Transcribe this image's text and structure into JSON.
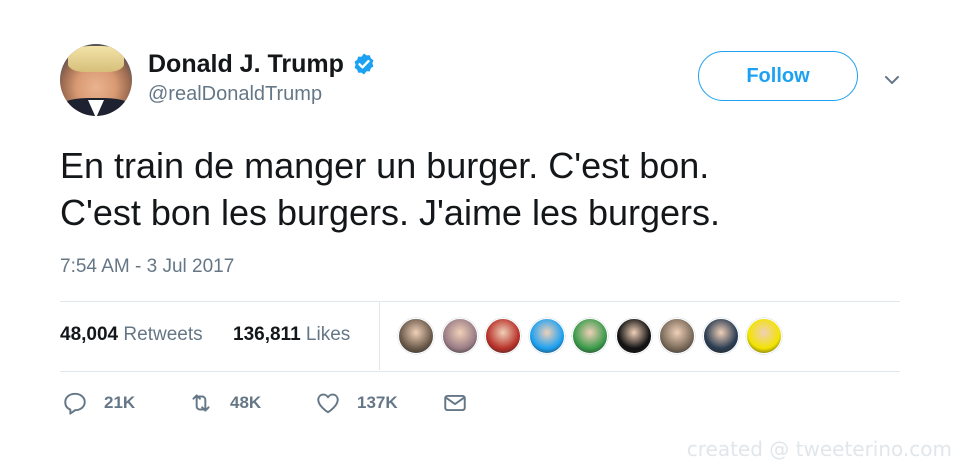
{
  "author": {
    "display_name": "Donald J. Trump",
    "handle": "@realDonaldTrump",
    "verified": true,
    "avatar_icon": "profile-photo"
  },
  "follow_label": "Follow",
  "tweet": {
    "line1": "En train de manger un burger. C'est bon.",
    "line2": "C'est bon les burgers. J'aime les burgers.",
    "timestamp": "7:54 AM - 3 Jul 2017"
  },
  "stats": {
    "retweets_count": "48,004",
    "retweets_label": "Retweets",
    "likes_count": "136,811",
    "likes_label": "Likes"
  },
  "likers": [
    {
      "icon": "liker-avatar-1",
      "color": "#6b5a4a"
    },
    {
      "icon": "liker-avatar-2",
      "color": "#9a7d86"
    },
    {
      "icon": "liker-avatar-3",
      "color": "#b8322a"
    },
    {
      "icon": "liker-avatar-4",
      "color": "#1da1f2"
    },
    {
      "icon": "liker-avatar-5",
      "color": "#3a9b4a"
    },
    {
      "icon": "liker-avatar-6",
      "color": "#111111"
    },
    {
      "icon": "liker-avatar-7",
      "color": "#7a6a5a"
    },
    {
      "icon": "liker-avatar-8",
      "color": "#2b3d52"
    },
    {
      "icon": "liker-avatar-9",
      "color": "#f2e300"
    }
  ],
  "actions": {
    "replies": "21K",
    "retweets": "48K",
    "likes": "137K"
  },
  "colors": {
    "accent": "#1da1f2",
    "secondary_text": "#657786",
    "primary_text": "#14171a",
    "divider": "#e1e8ed"
  },
  "watermark": "created @ tweeterino.com"
}
